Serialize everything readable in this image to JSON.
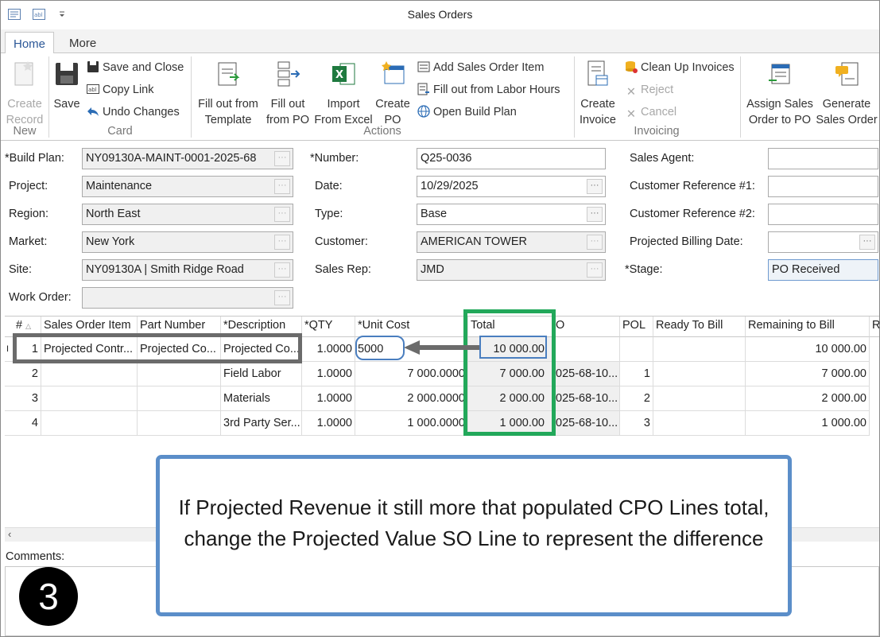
{
  "window": {
    "title": "Sales Orders"
  },
  "tabs": [
    "Home",
    "More"
  ],
  "ribbon": {
    "groups": {
      "new": "New",
      "card": "Card",
      "actions": "Actions",
      "invoicing": "Invoicing"
    },
    "create_record": "Create Record",
    "save": "Save",
    "save_and_close": "Save and Close",
    "copy_link": "Copy Link",
    "undo_changes": "Undo Changes",
    "fill_template": "Fill out from Template",
    "fill_po": "Fill out from PO",
    "import_excel": "Import From Excel",
    "create_po": "Create PO",
    "add_so_item": "Add Sales Order Item",
    "fill_labor": "Fill out from Labor Hours",
    "open_build_plan": "Open Build Plan",
    "create_invoice": "Create Invoice",
    "clean_up_invoices": "Clean Up Invoices",
    "reject": "Reject",
    "cancel": "Cancel",
    "assign_so_to_po": "Assign Sales Order to PO",
    "generate_so": "Generate Sales Order"
  },
  "form": {
    "build_plan": {
      "label": "*Build Plan:",
      "value": "NY09130A-MAINT-0001-2025-68"
    },
    "project": {
      "label": "Project:",
      "value": "Maintenance"
    },
    "region": {
      "label": "Region:",
      "value": "North East"
    },
    "market": {
      "label": "Market:",
      "value": "New York"
    },
    "site": {
      "label": "Site:",
      "value": "NY09130A | Smith Ridge Road"
    },
    "work_order": {
      "label": "Work Order:",
      "value": ""
    },
    "number": {
      "label": "*Number:",
      "value": "Q25-0036"
    },
    "date": {
      "label": "Date:",
      "value": "10/29/2025"
    },
    "type": {
      "label": "Type:",
      "value": "Base"
    },
    "customer": {
      "label": "Customer:",
      "value": "AMERICAN TOWER"
    },
    "sales_rep": {
      "label": "Sales Rep:",
      "value": "JMD"
    },
    "sales_agent": {
      "label": "Sales Agent:",
      "value": ""
    },
    "cust_ref1": {
      "label": "Customer Reference #1:",
      "value": ""
    },
    "cust_ref2": {
      "label": "Customer Reference #2:",
      "value": ""
    },
    "proj_billing_date": {
      "label": "Projected Billing Date:",
      "value": ""
    },
    "stage": {
      "label": "*Stage:",
      "value": "PO Received"
    }
  },
  "grid": {
    "columns": [
      "#",
      "Sales Order Item",
      "Part Number",
      "*Description",
      "*QTY",
      "*Unit Cost",
      "Total",
      "O",
      "POL",
      "Ready To Bill",
      "Remaining to Bill",
      "Re"
    ],
    "rows": [
      {
        "num": "1",
        "item": "Projected Contr...",
        "part": "Projected Co...",
        "desc": "Projected Co...",
        "qty": "1.0000",
        "cost": "5000",
        "total": "10 000.00",
        "po": "",
        "pol": "",
        "ready": "",
        "remaining": "10 000.00"
      },
      {
        "num": "2",
        "item": "",
        "part": "",
        "desc": "Field Labor",
        "qty": "1.0000",
        "cost": "7 000.0000",
        "total": "7 000.00",
        "po": "025-68-10...",
        "pol": "1",
        "ready": "",
        "remaining": "7 000.00"
      },
      {
        "num": "3",
        "item": "",
        "part": "",
        "desc": "Materials",
        "qty": "1.0000",
        "cost": "2 000.0000",
        "total": "2 000.00",
        "po": "025-68-10...",
        "pol": "2",
        "ready": "",
        "remaining": "2 000.00"
      },
      {
        "num": "4",
        "item": "",
        "part": "",
        "desc": "3rd Party Ser...",
        "qty": "1.0000",
        "cost": "1 000.0000",
        "total": "1 000.00",
        "po": "025-68-10...",
        "pol": "3",
        "ready": "",
        "remaining": "1 000.00"
      }
    ],
    "row_indicator": "I"
  },
  "comments": {
    "label": "Comments:"
  },
  "callout": {
    "text": "If Projected Revenue it still more that populated CPO Lines total, change the Projected Value SO Line to represent the difference"
  },
  "step_badge": "3"
}
